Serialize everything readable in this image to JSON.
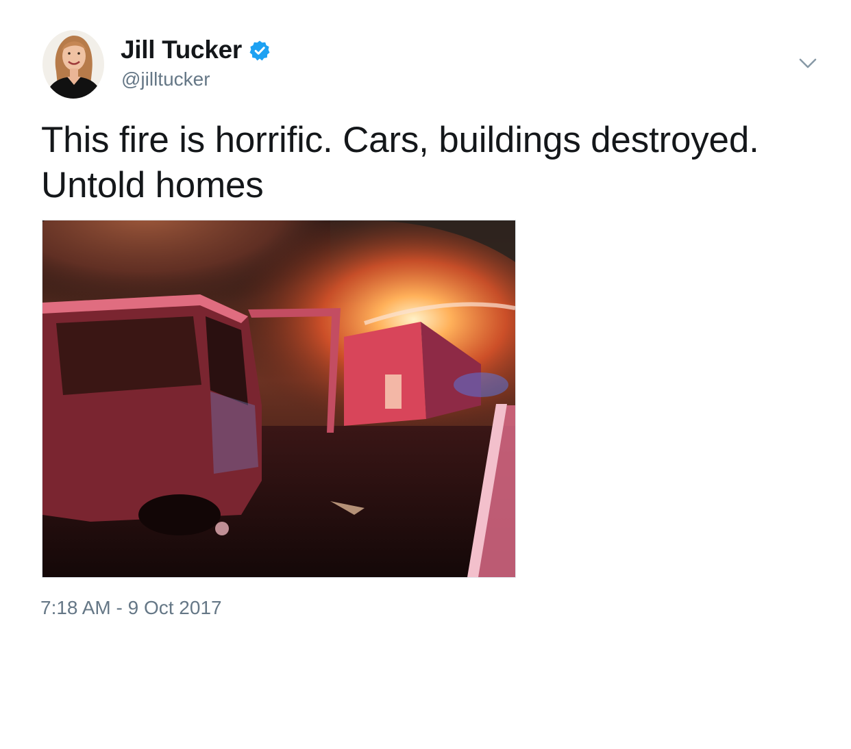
{
  "author": {
    "display_name": "Jill Tucker",
    "handle": "@jilltucker",
    "verified": true,
    "verified_badge_color": "#1da1f2",
    "avatar": "avatar-photo"
  },
  "tweet": {
    "text_lines": [
      "This fire is horrific. Cars, buildings destroyed.",
      "Untold homes"
    ],
    "media": {
      "kind": "photo",
      "subject": "burned-out truck and burning building at night"
    },
    "timestamp": "7:18 AM - 9 Oct 2017"
  },
  "menu": {
    "icon": "chevron-down-icon"
  },
  "colors": {
    "text": "#14171a",
    "secondary_text": "#657786",
    "background": "#ffffff"
  }
}
